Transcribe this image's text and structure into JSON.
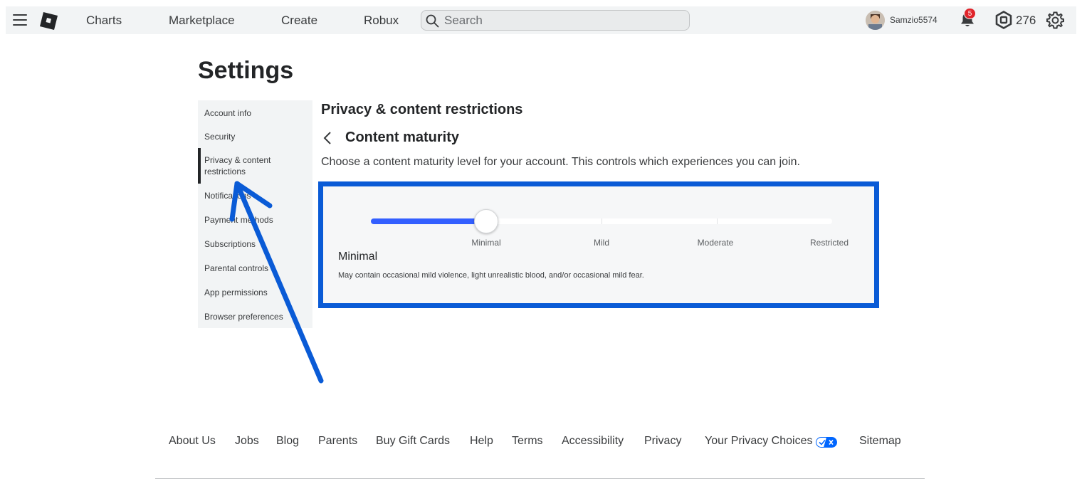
{
  "topbar": {
    "nav": [
      "Charts",
      "Marketplace",
      "Create",
      "Robux"
    ],
    "search_placeholder": "Search",
    "username": "Samzio5574",
    "notification_count": "5",
    "robux_balance": "276"
  },
  "settings": {
    "title": "Settings",
    "sidebar": [
      "Account info",
      "Security",
      "Privacy & content restrictions",
      "Notifications",
      "Payment methods",
      "Subscriptions",
      "Parental controls",
      "App permissions",
      "Browser preferences"
    ],
    "active_item": "Privacy & content restrictions",
    "section_title": "Privacy & content restrictions",
    "subsection_title": "Content maturity",
    "description": "Choose a content maturity level for your account. This controls which experiences you can join.",
    "maturity": {
      "levels": [
        "Minimal",
        "Mild",
        "Moderate",
        "Restricted"
      ],
      "selected_level": "Minimal",
      "selected_index": 0,
      "selected_description": "May contain occasional mild violence, light unrealistic blood, and/or occasional mild fear."
    }
  },
  "footer": {
    "links": [
      "About Us",
      "Jobs",
      "Blog",
      "Parents",
      "Buy Gift Cards",
      "Help",
      "Terms",
      "Accessibility",
      "Privacy",
      "Your Privacy Choices",
      "Sitemap"
    ]
  },
  "colors": {
    "accent_blue": "#335fff",
    "highlight_box": "#0a5bd6",
    "badge_red": "#e0242a"
  }
}
